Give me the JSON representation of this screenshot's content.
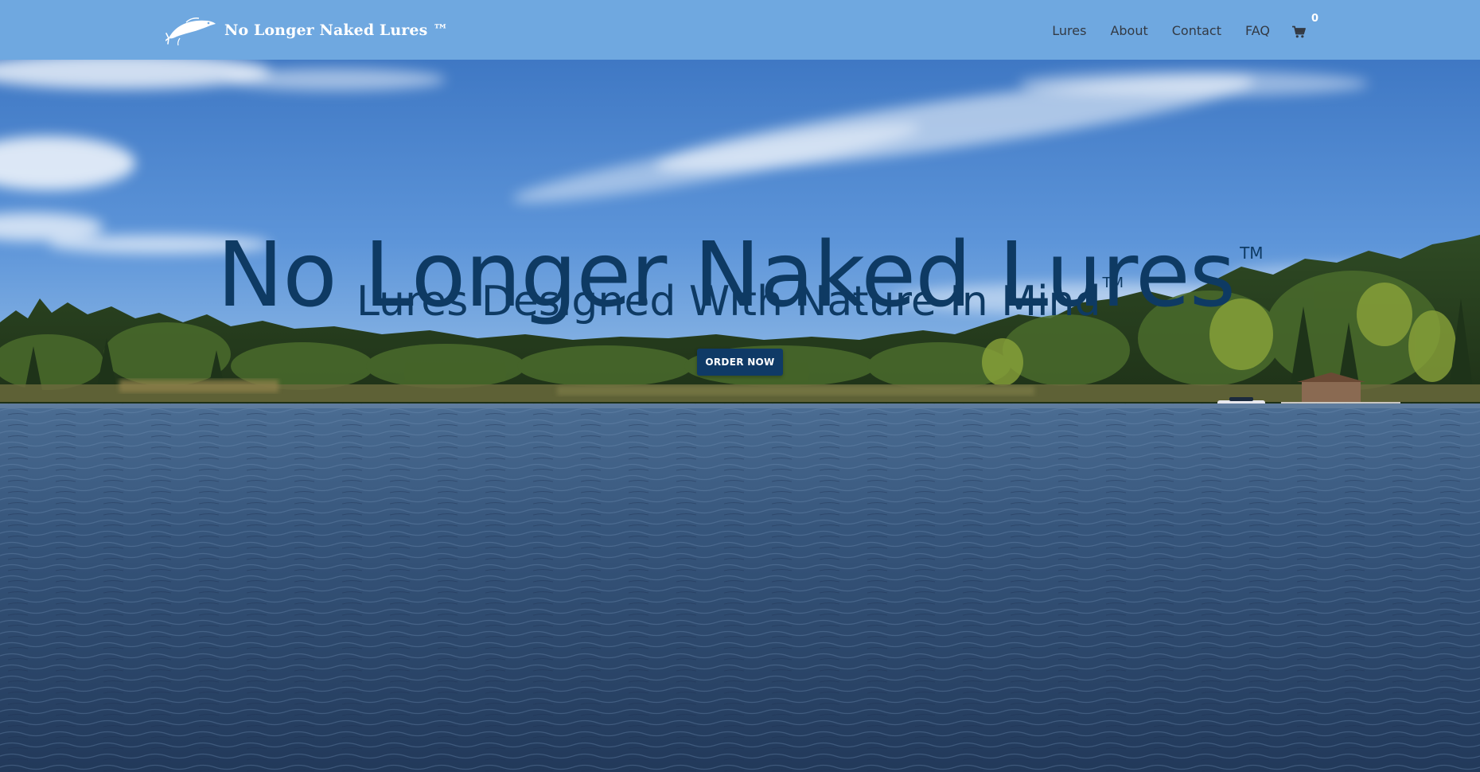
{
  "header": {
    "brand": "No Longer Naked Lures ™",
    "nav": [
      {
        "label": "Lures"
      },
      {
        "label": "About"
      },
      {
        "label": "Contact"
      },
      {
        "label": "FAQ"
      }
    ],
    "cart_count": "0"
  },
  "hero": {
    "title": "No Longer Naked Lures",
    "title_mark": "TM",
    "subtitle": "Lures Designed With Nature In Mind",
    "subtitle_mark": "TM",
    "cta_label": "ORDER NOW"
  },
  "icons": {
    "logo": "fish-logo-icon",
    "cart": "shopping-cart-icon"
  },
  "colors": {
    "header_bg": "#6fa8e0",
    "brand_text": "#ffffff",
    "nav_text": "#333a44",
    "hero_text": "#0e3a63",
    "cta_bg": "#0f3a66",
    "cta_text": "#ffffff"
  }
}
